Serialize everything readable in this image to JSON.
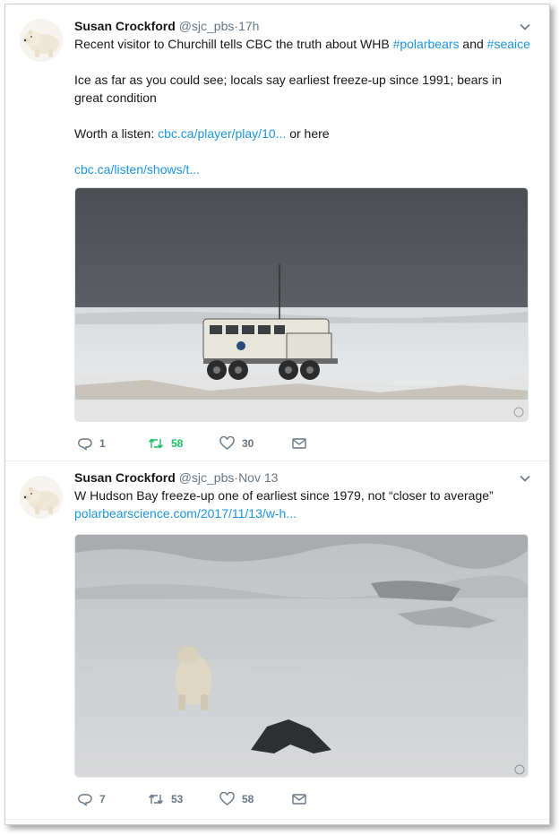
{
  "tweets": [
    {
      "author_name": "Susan Crockford",
      "handle": "@sjc_pbs",
      "separator": "·",
      "time": "17h",
      "text_line1_prefix": "Recent visitor to Churchill tells CBC the truth about WHB ",
      "hashtag1": "#polarbears",
      "text_line1_mid": " and ",
      "hashtag2": "#seaice",
      "text_para2": "Ice as far as you could see; locals say earliest freeze-up since 1991; bears in great condition",
      "text_para3_prefix": "Worth a listen: ",
      "link1": "cbc.ca/player/play/10...",
      "text_para3_suffix": " or here",
      "link2": "cbc.ca/listen/shows/t...",
      "media_description": "tundra-buggy-on-snow-photo",
      "reply_count": "1",
      "retweet_count": "58",
      "like_count": "30",
      "retweeted": true
    },
    {
      "author_name": "Susan Crockford",
      "handle": "@sjc_pbs",
      "separator": "·",
      "time": "Nov 13",
      "text": "W Hudson Bay freeze-up one of earliest since 1979, not “closer to average”",
      "link": "polarbearscience.com/2017/11/13/w-h...",
      "media_description": "polar-bear-on-ice-photo",
      "reply_count": "7",
      "retweet_count": "53",
      "like_count": "58",
      "retweeted": false
    }
  ],
  "colors": {
    "link": "#1b95e0",
    "muted": "#657786",
    "retweet_active": "#17bf63"
  }
}
